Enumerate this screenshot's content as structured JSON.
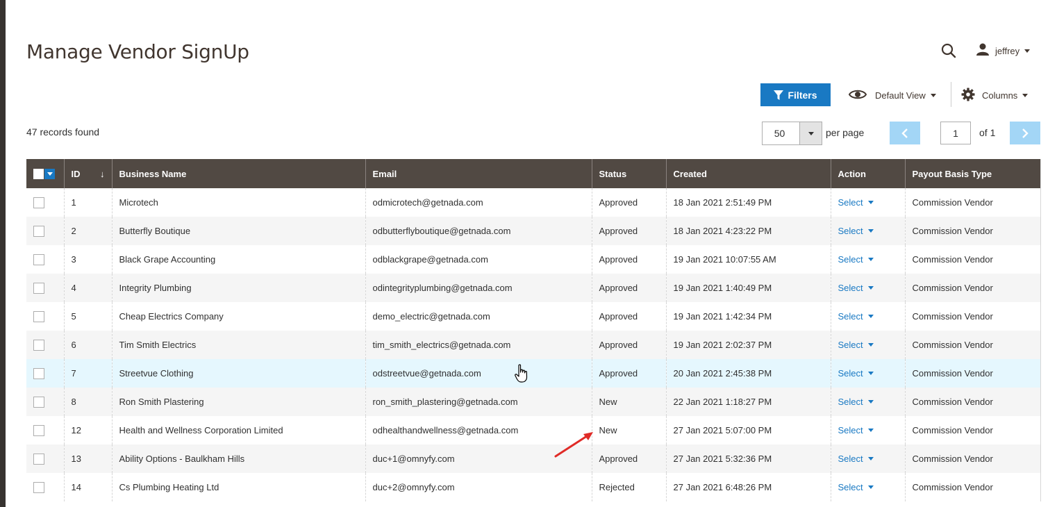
{
  "page": {
    "title": "Manage Vendor SignUp"
  },
  "header": {
    "user_name": "jeffrey",
    "search_icon": "search-icon",
    "user_icon": "user-icon"
  },
  "toolbar": {
    "filters_label": "Filters",
    "view_label": "Default View",
    "columns_label": "Columns",
    "records_found": "47 records found",
    "per_page_value": "50",
    "per_page_label": "per page",
    "current_page": "1",
    "page_of": "of 1"
  },
  "colors": {
    "accent": "#1979c3",
    "header_bg": "#514943",
    "pager_bg": "#a3d6f6",
    "arrow": "#e02b27"
  },
  "table": {
    "columns": [
      "ID",
      "Business Name",
      "Email",
      "Status",
      "Created",
      "Action",
      "Payout Basis Type"
    ],
    "rows": [
      {
        "id": "1",
        "business": "Microtech",
        "email": "odmicrotech@getnada.com",
        "status": "Approved",
        "created": "18 Jan 2021 2:51:49 PM",
        "action": "Select",
        "payout": "Commission Vendor"
      },
      {
        "id": "2",
        "business": "Butterfly Boutique",
        "email": "odbutterflyboutique@getnada.com",
        "status": "Approved",
        "created": "18 Jan 2021 4:23:22 PM",
        "action": "Select",
        "payout": "Commission Vendor"
      },
      {
        "id": "3",
        "business": "Black Grape Accounting",
        "email": "odblackgrape@getnada.com",
        "status": "Approved",
        "created": "19 Jan 2021 10:07:55 AM",
        "action": "Select",
        "payout": "Commission Vendor"
      },
      {
        "id": "4",
        "business": "Integrity Plumbing",
        "email": "odintegrityplumbing@getnada.com",
        "status": "Approved",
        "created": "19 Jan 2021 1:40:49 PM",
        "action": "Select",
        "payout": "Commission Vendor"
      },
      {
        "id": "5",
        "business": "Cheap Electrics Company",
        "email": "demo_electric@getnada.com",
        "status": "Approved",
        "created": "19 Jan 2021 1:42:34 PM",
        "action": "Select",
        "payout": "Commission Vendor"
      },
      {
        "id": "6",
        "business": "Tim Smith Electrics",
        "email": "tim_smith_electrics@getnada.com",
        "status": "Approved",
        "created": "19 Jan 2021 2:02:37 PM",
        "action": "Select",
        "payout": "Commission Vendor"
      },
      {
        "id": "7",
        "business": "Streetvue Clothing",
        "email": "odstreetvue@getnada.com",
        "status": "Approved",
        "created": "20 Jan 2021 2:45:38 PM",
        "action": "Select",
        "payout": "Commission Vendor"
      },
      {
        "id": "8",
        "business": "Ron Smith Plastering",
        "email": "ron_smith_plastering@getnada.com",
        "status": "New",
        "created": "22 Jan 2021 1:18:27 PM",
        "action": "Select",
        "payout": "Commission Vendor"
      },
      {
        "id": "12",
        "business": "Health and Wellness Corporation Limited",
        "email": "odhealthandwellness@getnada.com",
        "status": "New",
        "created": "27 Jan 2021 5:07:00 PM",
        "action": "Select",
        "payout": "Commission Vendor"
      },
      {
        "id": "13",
        "business": "Ability Options - Baulkham Hills",
        "email": "duc+1@omnyfy.com",
        "status": "Approved",
        "created": "27 Jan 2021 5:32:36 PM",
        "action": "Select",
        "payout": "Commission Vendor"
      },
      {
        "id": "14",
        "business": "Cs Plumbing Heating Ltd",
        "email": "duc+2@omnyfy.com",
        "status": "Rejected",
        "created": "27 Jan 2021 6:48:26 PM",
        "action": "Select",
        "payout": "Commission Vendor"
      }
    ]
  }
}
